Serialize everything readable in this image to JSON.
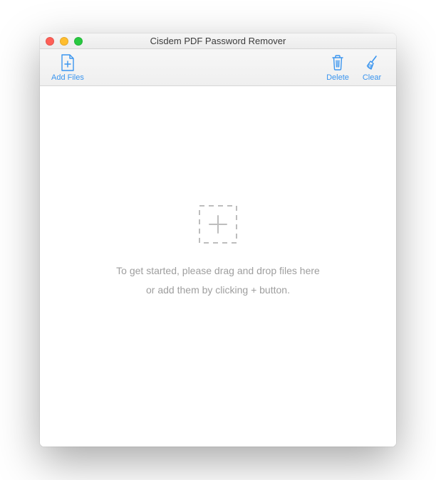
{
  "window": {
    "title": "Cisdem PDF Password Remover"
  },
  "toolbar": {
    "add_files_label": "Add Files",
    "delete_label": "Delete",
    "clear_label": "Clear"
  },
  "content": {
    "hint_line1": "To get started, please drag and drop files here",
    "hint_line2": "or add them by clicking + button."
  },
  "colors": {
    "accent": "#3a95ef",
    "muted": "#9e9e9e",
    "dashed": "#bdbdbd"
  }
}
